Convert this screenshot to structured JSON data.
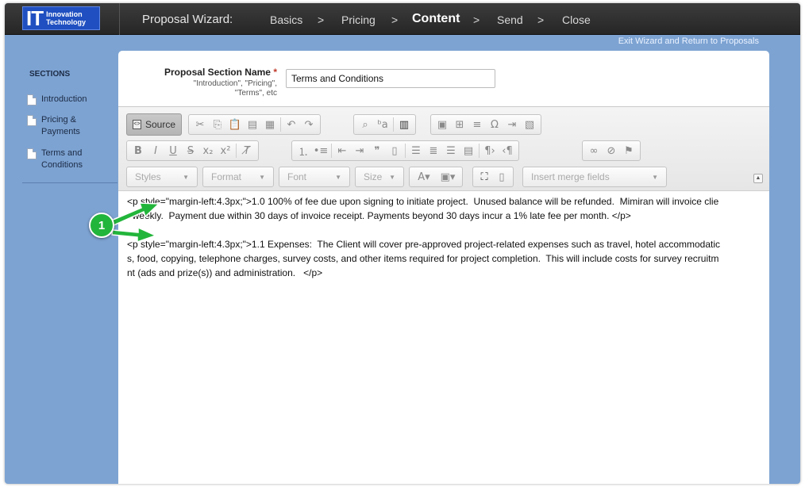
{
  "logo": {
    "it": "IT",
    "line1": "Innovation",
    "line2": "Technology"
  },
  "wizard": {
    "title": "Proposal Wizard:",
    "steps": [
      "Basics",
      "Pricing",
      "Content",
      "Send",
      "Close"
    ],
    "active_step": "Content",
    "separator": ">"
  },
  "exit_link": "Exit Wizard and Return to Proposals",
  "sidebar": {
    "title": "SECTIONS",
    "items": [
      {
        "label_line1": "Introduction",
        "label_line2": ""
      },
      {
        "label_line1": "Pricing &",
        "label_line2": "Payments"
      },
      {
        "label_line1": "Terms and",
        "label_line2": "Conditions"
      }
    ]
  },
  "form": {
    "name_label": "Proposal Section Name",
    "required_mark": "*",
    "hint_line1": "\"Introduction\", \"Pricing\",",
    "hint_line2": "\"Terms\", etc",
    "name_value": "Terms and Conditions"
  },
  "toolbar": {
    "source_label": "Source",
    "styles_label": "Styles",
    "format_label": "Format",
    "font_label": "Font",
    "size_label": "Size",
    "merge_label": "Insert merge fields"
  },
  "content": {
    "lines": [
      "<p style=\"margin-left:4.3px;\">1.0 100% of fee due upon signing to initiate project.  Unused balance will be refunded.  Mimiran will invoice clie",
      "t weekly.  Payment due within 30 days of invoice receipt. Payments beyond 30 days incur a 1% late fee per month. </p>",
      "<p style=\"margin-left:4.3px;\">1.1 Expenses:  The Client will cover pre-approved project-related expenses such as travel, hotel accommodatic",
      "s, food, copying, telephone charges, survey costs, and other items required for project completion.  This will include costs for survey recruitm",
      "nt (ads and prize(s)) and administration.   </p>"
    ]
  },
  "callout": {
    "number": "1"
  },
  "colors": {
    "page_bg": "#7da3d2",
    "topbar": "#2e2e2e",
    "logo_blue": "#1f4fc0",
    "callout_green": "#22b53b",
    "required_red": "#c0392b"
  }
}
